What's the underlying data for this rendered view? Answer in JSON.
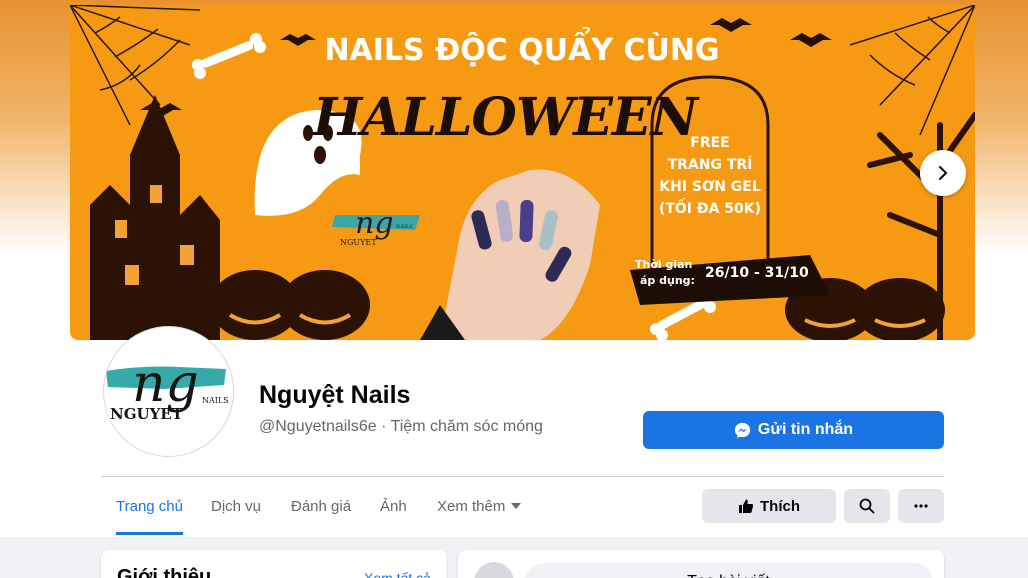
{
  "cover": {
    "headline": "NAILS ĐỘC QUẨY CÙNG",
    "halloween": "HALLOWEEN",
    "offer_lines": [
      "FREE",
      "TRANG TRÍ",
      "KHI SƠN GEL",
      "(TỐI ĐA 50K)"
    ],
    "period_label_1": "Thời gian",
    "period_label_2": "áp dụng:",
    "period_dates": "26/10 - 31/10",
    "logo_letters": "ng",
    "logo_name": "NGUYET",
    "logo_sub": "NAILS",
    "next_icon": "chevron-right-icon"
  },
  "profile": {
    "avatar_letters": "ng",
    "avatar_name": "NGUYET",
    "avatar_sub": "NAILS",
    "name": "Nguyệt Nails",
    "subtitle": "@Nguyetnails6e · Tiệm chăm sóc móng",
    "message_button": "Gửi tin nhắn",
    "message_icon": "messenger-icon"
  },
  "tabs": [
    {
      "label": "Trang chủ",
      "active": true
    },
    {
      "label": "Dịch vụ",
      "active": false
    },
    {
      "label": "Đánh giá",
      "active": false
    },
    {
      "label": "Ảnh",
      "active": false
    },
    {
      "label": "Xem thêm",
      "active": false
    }
  ],
  "actions": {
    "like_label": "Thích",
    "like_icon": "thumbs-up-icon",
    "search_icon": "search-icon",
    "more_icon": "more-horizontal-icon"
  },
  "intro": {
    "title": "Giới thiệu",
    "see_all": "Xem tất cả"
  },
  "composer": {
    "placeholder": "Tạo bài viết"
  },
  "colors": {
    "accent": "#1b74e4",
    "cover_orange": "#f59a12",
    "page_bg": "#f0f2f5"
  }
}
